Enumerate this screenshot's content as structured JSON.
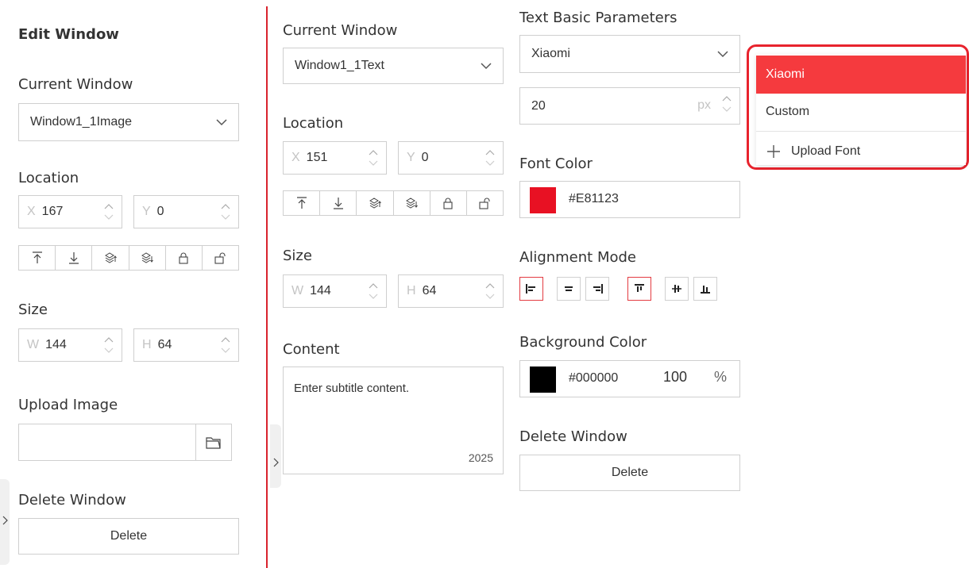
{
  "panel1": {
    "title": "Edit Window",
    "current_window_label": "Current Window",
    "current_window_value": "Window1_1Image",
    "location_label": "Location",
    "x_axis": "X",
    "x_value": "167",
    "y_axis": "Y",
    "y_value": "0",
    "size_label": "Size",
    "w_axis": "W",
    "w_value": "144",
    "h_axis": "H",
    "h_value": "64",
    "upload_label": "Upload Image",
    "delete_window_label": "Delete Window",
    "delete_button": "Delete"
  },
  "panel2": {
    "current_window_label": "Current Window",
    "current_window_value": "Window1_1Text",
    "location_label": "Location",
    "x_axis": "X",
    "x_value": "151",
    "y_axis": "Y",
    "y_value": "0",
    "size_label": "Size",
    "w_axis": "W",
    "w_value": "144",
    "h_axis": "H",
    "h_value": "64",
    "content_label": "Content",
    "content_placeholder": "Enter subtitle content.",
    "content_counter": "2025"
  },
  "panel3": {
    "title": "Text Basic Parameters",
    "font_value": "Xiaomi",
    "font_size": "20",
    "font_size_unit": "px",
    "font_color_label": "Font Color",
    "font_color_hex": "#E81123",
    "alignment_label": "Alignment Mode",
    "background_label": "Background Color",
    "background_hex": "#000000",
    "opacity_value": "100",
    "opacity_unit": "%",
    "delete_window_label": "Delete Window",
    "delete_button": "Delete"
  },
  "font_dropdown": {
    "options": [
      "Xiaomi",
      "Custom"
    ],
    "selected": "Xiaomi",
    "upload_label": "Upload Font"
  },
  "colors": {
    "accent": "#F53A3E",
    "divider": "#D9232D",
    "font_color_swatch": "#E81123",
    "bg_color_swatch": "#000000"
  }
}
